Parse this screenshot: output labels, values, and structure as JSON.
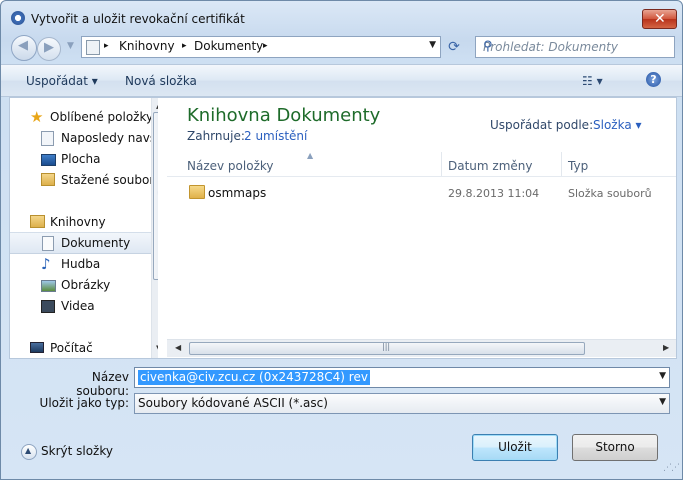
{
  "window": {
    "title": "Vytvořit a uložit revokační certifikát"
  },
  "address": {
    "crumbs": [
      "Knihovny",
      "Dokumenty"
    ],
    "separators": [
      "▸",
      "▸",
      "▸"
    ]
  },
  "search": {
    "placeholder": "Prohledat: Dokumenty"
  },
  "toolbar": {
    "organize": "Uspořádat ▾",
    "new_folder": "Nová složka"
  },
  "sidebar": {
    "favorites": "Oblíbené položky",
    "items": [
      {
        "label": "Naposledy navští"
      },
      {
        "label": "Plocha"
      },
      {
        "label": "Stažené soubory"
      }
    ],
    "libraries": "Knihovny",
    "lib_items": [
      {
        "label": "Dokumenty"
      },
      {
        "label": "Hudba"
      },
      {
        "label": "Obrázky"
      },
      {
        "label": "Videa"
      }
    ],
    "computer": "Počítač"
  },
  "library": {
    "title": "Knihovna Dokumenty",
    "includes_label": "Zahrnuje:",
    "includes_link": "2 umístění",
    "sort_label": "Uspořádat podle:",
    "sort_value": "Složka ▾"
  },
  "columns": {
    "name": "Název položky",
    "date": "Datum změny",
    "type": "Typ"
  },
  "files": [
    {
      "name": "osmmaps",
      "date": "29.8.2013 11:04",
      "type": "Složka souborů"
    }
  ],
  "form": {
    "filename_label": "Název souboru:",
    "filename_value": "civenka@civ.zcu.cz (0x243728C4) rev",
    "filetype_label": "Uložit jako typ:",
    "filetype_value": "Soubory kódované ASCII (*.asc)"
  },
  "footer": {
    "hide_folders": "Skrýt složky",
    "save": "Uložit",
    "cancel": "Storno"
  }
}
